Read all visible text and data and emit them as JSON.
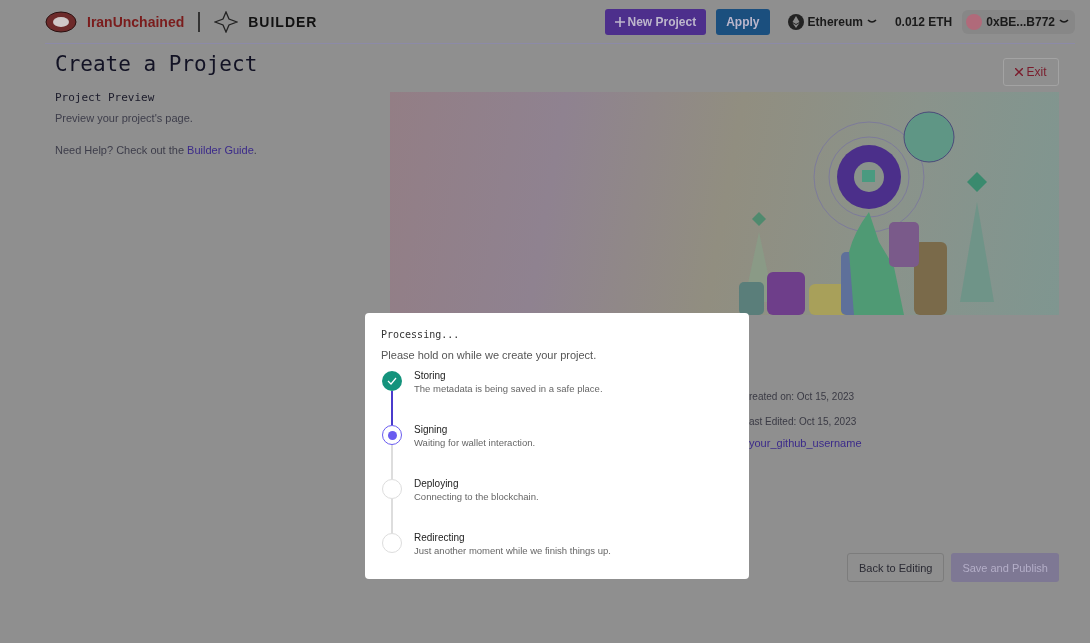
{
  "header": {
    "brand": "IranUnchained",
    "product": "BUILDER",
    "new_project": "New Project",
    "apply": "Apply",
    "network": "Ethereum",
    "balance": "0.012 ETH",
    "account": "0xBE...B772"
  },
  "page": {
    "title": "Create a Project",
    "exit": "Exit",
    "section_title": "Project Preview",
    "section_subtitle": "Preview your project's page.",
    "help_text": "Need Help? Check out the ",
    "help_link": "Builder Guide",
    "help_end": "."
  },
  "details": [
    {
      "kind": "text",
      "text": "reated on: Oct 15, 2023"
    },
    {
      "kind": "text",
      "text": "ast Edited: Oct 15, 2023"
    },
    {
      "kind": "link",
      "text": "your_github_username"
    }
  ],
  "actions": [
    {
      "label": "Back to Editing",
      "disabled": false,
      "kind": "secondary"
    },
    {
      "label": "Save and Publish",
      "disabled": true,
      "kind": "primary"
    }
  ],
  "modal": {
    "title": "Processing...",
    "subtitle": "Please hold on while we create your project.",
    "steps": [
      {
        "title": "Storing",
        "description": "The metadata is being saved in a safe place.",
        "done": true,
        "active": false
      },
      {
        "title": "Signing",
        "description": "Waiting for wallet interaction.",
        "done": false,
        "active": true
      },
      {
        "title": "Deploying",
        "description": "Connecting to the blockchain.",
        "done": false,
        "active": false
      },
      {
        "title": "Redirecting",
        "description": "Just another moment while we finish things up.",
        "done": false,
        "active": false
      }
    ]
  }
}
